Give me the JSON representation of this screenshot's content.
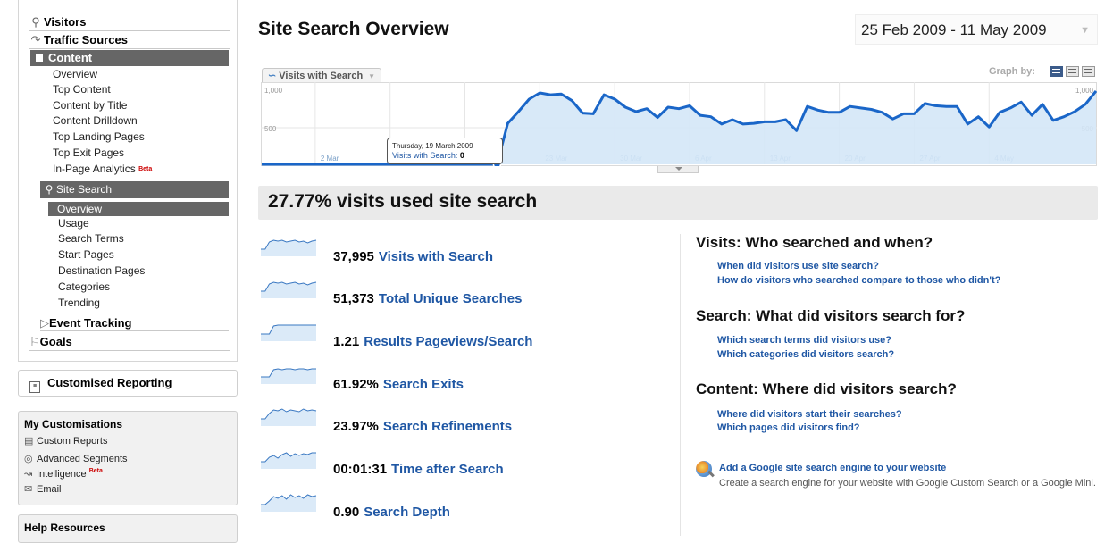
{
  "sidebar": {
    "sections": {
      "visitors": "Visitors",
      "traffic_sources": "Traffic Sources",
      "content": "Content",
      "event_tracking": "Event Tracking",
      "goals": "Goals"
    },
    "content_items": [
      "Overview",
      "Top Content",
      "Content by Title",
      "Content Drilldown",
      "Top Landing Pages",
      "Top Exit Pages",
      "In-Page Analytics"
    ],
    "beta_label": "Beta",
    "site_search": {
      "label": "Site Search",
      "items": [
        "Overview",
        "Usage",
        "Search Terms",
        "Start Pages",
        "Destination Pages",
        "Categories",
        "Trending"
      ],
      "selected": "Overview"
    },
    "customised_reporting": "Customised Reporting",
    "my_customisations": {
      "title": "My Customisations",
      "items": [
        "Custom Reports",
        "Advanced Segments",
        "Intelligence",
        "Email"
      ]
    },
    "help_resources": "Help Resources"
  },
  "header": {
    "title": "Site Search Overview",
    "date_range": "25 Feb 2009 - 11 May 2009"
  },
  "graph": {
    "metric_selector": "Visits with Search",
    "graph_by_label": "Graph by:"
  },
  "chart_data": {
    "type": "area",
    "series": [
      {
        "name": "Visits with Search",
        "values": [
          0,
          0,
          0,
          0,
          0,
          0,
          0,
          0,
          0,
          0,
          0,
          0,
          0,
          0,
          0,
          0,
          0,
          0,
          0,
          0,
          0,
          0,
          0,
          560,
          720,
          890,
          975,
          950,
          960,
          870,
          700,
          690,
          950,
          890,
          780,
          720,
          760,
          640,
          780,
          760,
          800,
          670,
          650,
          550,
          610,
          550,
          560,
          580,
          580,
          610,
          460,
          790,
          740,
          710,
          710,
          790,
          770,
          750,
          710,
          620,
          690,
          690,
          830,
          800,
          790,
          790,
          550,
          650,
          510,
          710,
          770,
          850,
          670,
          820,
          600,
          650,
          720,
          820,
          1000
        ],
        "color": "#1a66c8",
        "fill": "#d4e7f7"
      }
    ],
    "x_start": "2009-02-25",
    "x_end": "2009-05-11",
    "x_tick_labels": [
      "2 Mar",
      "9 Mar",
      "16 Mar",
      "23 Mar",
      "30 Mar",
      "6 Apr",
      "13 Apr",
      "20 Apr",
      "27 Apr",
      "4 May"
    ],
    "y_tick_labels": [
      "1,000",
      "500"
    ],
    "ylim": [
      0,
      1000
    ],
    "grid": true,
    "tooltip": {
      "date": "Thursday, 19 March 2009",
      "metric": "Visits with Search:",
      "value": "0"
    }
  },
  "summary": {
    "headline": "27.77% visits used site search"
  },
  "metrics": [
    {
      "value": "37,995",
      "label": "Visits with Search"
    },
    {
      "value": "51,373",
      "label": "Total Unique Searches"
    },
    {
      "value": "1.21",
      "label": "Results Pageviews/Search"
    },
    {
      "value": "61.92%",
      "label": "Search Exits"
    },
    {
      "value": "23.97%",
      "label": "Search Refinements"
    },
    {
      "value": "00:01:31",
      "label": "Time after Search"
    },
    {
      "value": "0.90",
      "label": "Search Depth"
    }
  ],
  "questions": [
    {
      "heading": "Visits: Who searched and when?",
      "links": [
        "When did visitors use site search?",
        "How do visitors who searched compare to those who didn't?"
      ]
    },
    {
      "heading": "Search: What did visitors search for?",
      "links": [
        "Which search terms did visitors use?",
        "Which categories did visitors search?"
      ]
    },
    {
      "heading": "Content: Where did visitors search?",
      "links": [
        "Where did visitors start their searches?",
        "Which pages did visitors find?"
      ]
    }
  ],
  "google_cse": {
    "title": "Add a Google site search engine to your website",
    "description": "Create a search engine for your website with Google Custom Search or a Google Mini."
  }
}
